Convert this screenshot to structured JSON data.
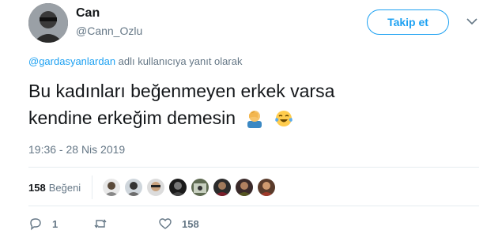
{
  "author": {
    "display_name": "Can",
    "handle": "@Cann_Ozlu"
  },
  "follow_button": {
    "label": "Takip et"
  },
  "reply_context": {
    "mention": "@gardasyanlardan",
    "suffix": " adlı kullanıcıya yanıt olarak"
  },
  "tweet": {
    "line1": "Bu kadınları beğenmeyen erkek varsa",
    "line2": "kendine erkeğim demesin",
    "emojis": [
      "facepalm-emoji",
      "tears-of-joy-emoji"
    ]
  },
  "timestamp": "19:36 - 28 Nis 2019",
  "likes": {
    "count": "158",
    "label": "Beğeni",
    "liker_avatars": 8
  },
  "actions": {
    "reply_count": "1",
    "retweet_count": "",
    "like_count": "158"
  },
  "colors": {
    "accent": "#1da1f2",
    "muted": "#657786",
    "text": "#14171a",
    "divider": "#e6ecf0"
  }
}
